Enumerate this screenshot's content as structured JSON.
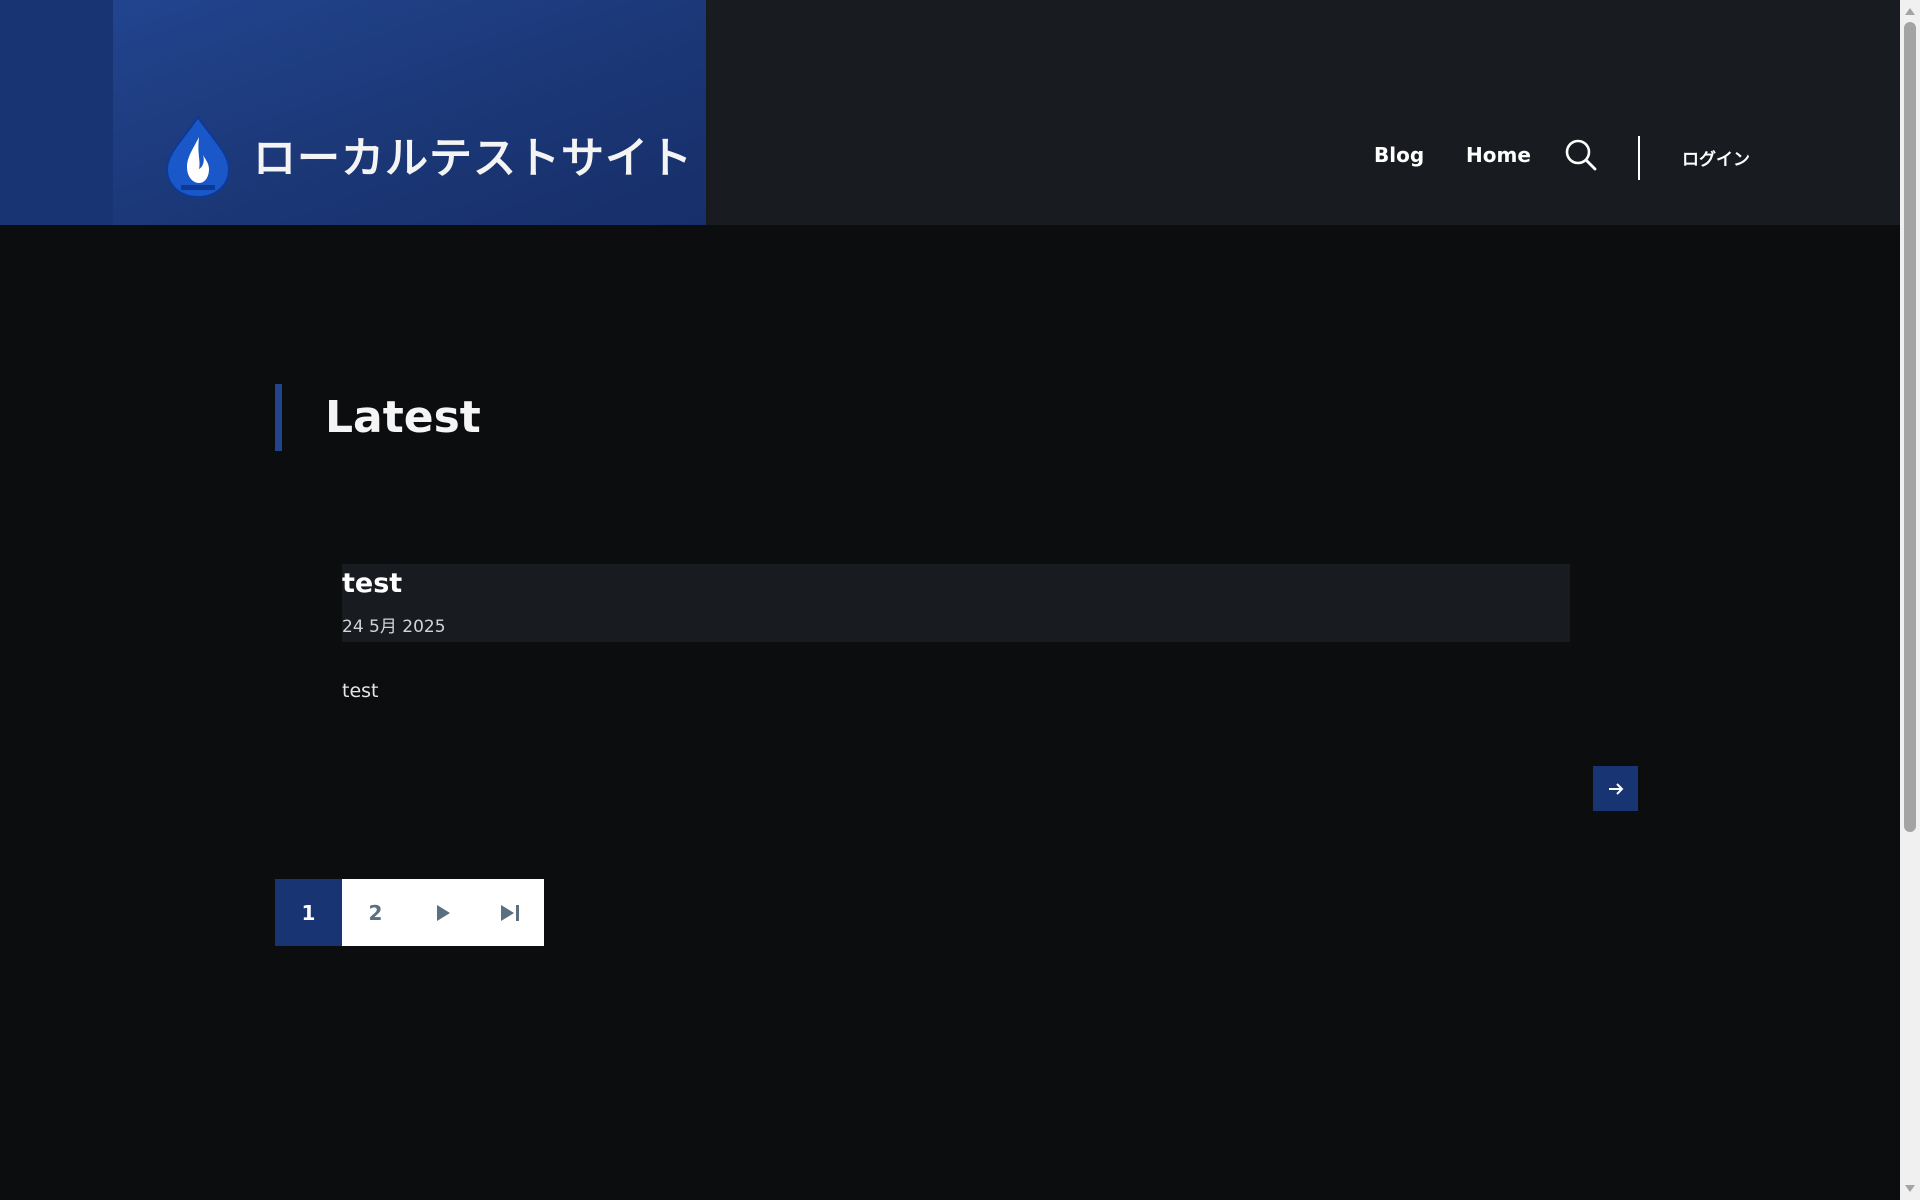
{
  "header": {
    "site_name": "ローカルテストサイト",
    "logo_icon": "flame-droplet-logo",
    "nav": [
      {
        "label": "Blog"
      },
      {
        "label": "Home"
      }
    ],
    "search_icon": "search-icon",
    "login_label": "ログイン"
  },
  "main": {
    "section_title": "Latest",
    "articles": [
      {
        "title": "test",
        "date": "24 5月 2025",
        "body": "test",
        "read_more_icon": "arrow-right-icon"
      }
    ],
    "pager": {
      "current": "1",
      "pages": [
        "1",
        "2"
      ],
      "next_icon": "play-next-icon",
      "last_icon": "skip-last-icon"
    }
  },
  "colors": {
    "brand_blue": "#22448f",
    "header_bg": "#181c20",
    "page_bg": "#0c0d0f"
  }
}
